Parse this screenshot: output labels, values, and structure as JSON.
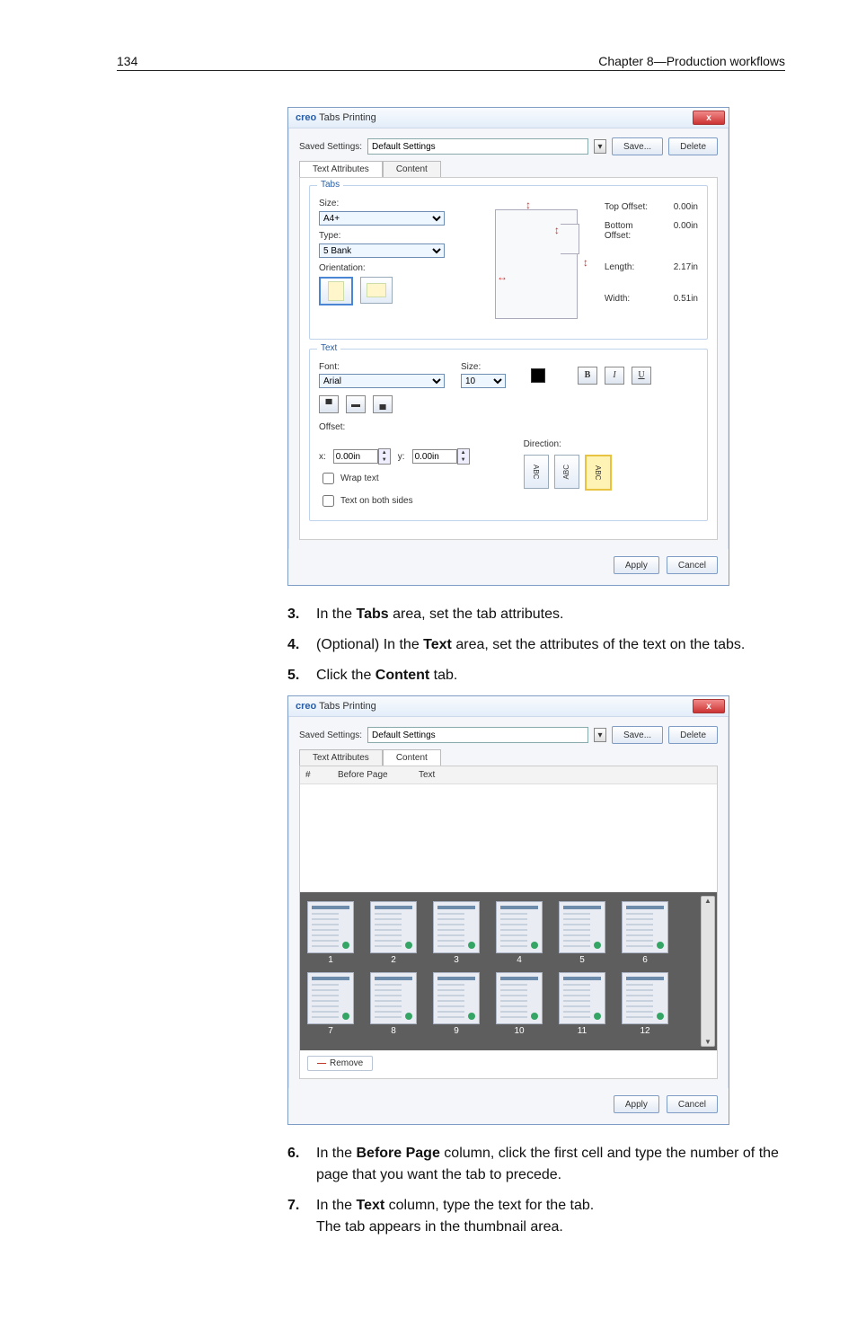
{
  "header": {
    "page_number": "134",
    "chapter": "Chapter 8—Production workflows"
  },
  "steps": {
    "s3": {
      "n": "3.",
      "pre": "In the ",
      "b1": "Tabs",
      "post": " area, set the tab attributes."
    },
    "s4": {
      "n": "4.",
      "pre": "(Optional) In the ",
      "b1": "Text",
      "mid": " area, set the attributes of the text on the tabs."
    },
    "s5": {
      "n": "5.",
      "pre": "Click the ",
      "b1": "Content",
      "post": " tab."
    },
    "s6": {
      "n": "6.",
      "pre": "In the ",
      "b1": "Before Page",
      "mid": " column, click the first cell and type the number of the page that you want the tab to precede."
    },
    "s7": {
      "n": "7.",
      "pre": "In the ",
      "b1": "Text",
      "mid": " column, type the text for the tab.",
      "line2": "The tab appears in the thumbnail area."
    }
  },
  "dialog": {
    "title_prefix": "creo",
    "title": " Tabs Printing",
    "close": "x",
    "saved_label": "Saved Settings:",
    "saved_value": "Default Settings",
    "save_btn": "Save...",
    "delete_btn": "Delete",
    "apply_btn": "Apply",
    "cancel_btn": "Cancel",
    "tab_text_attr": "Text Attributes",
    "tab_content": "Content",
    "tabs_group": {
      "title": "Tabs",
      "size_label": "Size:",
      "size_value": "A4+",
      "type_label": "Type:",
      "type_value": "5 Bank",
      "orient_label": "Orientation:",
      "meas": {
        "top_offset_l": "Top Offset:",
        "top_offset_v": "0.00in",
        "bot_offset_l": "Bottom Offset:",
        "bot_offset_v": "0.00in",
        "length_l": "Length:",
        "length_v": "2.17in",
        "width_l": "Width:",
        "width_v": "0.51in"
      }
    },
    "text_group": {
      "title": "Text",
      "font_l": "Font:",
      "font_v": "Arial",
      "size_l": "Size:",
      "size_v": "10",
      "b": "B",
      "i": "I",
      "u": "U",
      "offset_l": "Offset:",
      "x_l": "x:",
      "x_v": "0.00in",
      "y_l": "y:",
      "y_v": "0.00in",
      "direction_l": "Direction:",
      "dir1": "ABC",
      "dir2": "ABC",
      "dir3": "ABC",
      "wrap": "Wrap text",
      "both": "Text on both sides"
    }
  },
  "dialog2": {
    "table": {
      "c1": "#",
      "c2": "Before Page",
      "c3": "Text"
    },
    "remove": "Remove",
    "thumbs": [
      "1",
      "2",
      "3",
      "4",
      "5",
      "6",
      "7",
      "8",
      "9",
      "10",
      "11",
      "12"
    ]
  }
}
